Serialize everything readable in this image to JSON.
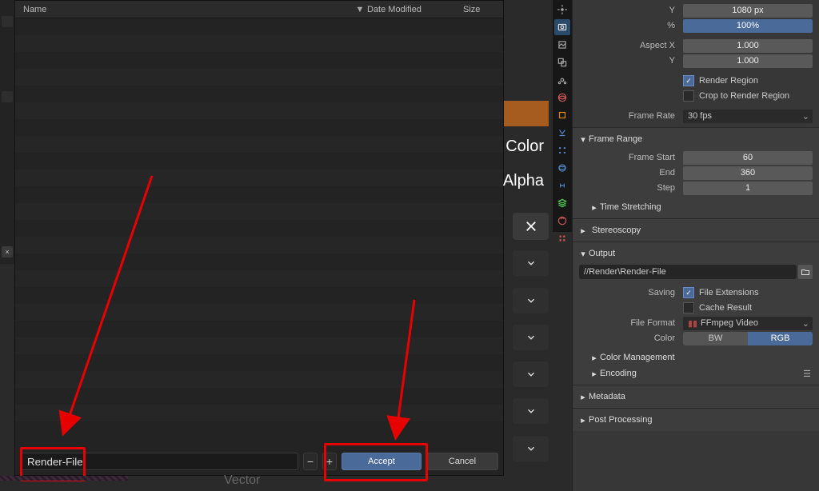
{
  "file_browser": {
    "cols": {
      "name": "Name",
      "date": "Date Modified",
      "size": "Size"
    },
    "sort_indicator": "▼",
    "filename": "Render-File",
    "minus": "−",
    "plus": "+",
    "accept": "Accept",
    "cancel": "Cancel",
    "rail_x": "×"
  },
  "mid": {
    "color": "Color",
    "alpha": "Alpha",
    "close": "×",
    "below_text": "Vector"
  },
  "props": {
    "res_y_label": "Y",
    "res_y": "1080 px",
    "pct_label": "%",
    "pct": "100%",
    "aspect_x_label": "Aspect X",
    "aspect_x": "1.000",
    "aspect_y_label": "Y",
    "aspect_y": "1.000",
    "render_region": "Render Region",
    "crop_region": "Crop to Render Region",
    "frame_rate_label": "Frame Rate",
    "frame_rate": "30 fps",
    "sections": {
      "frame_range": "Frame Range",
      "time_stretching": "Time Stretching",
      "stereoscopy": "Stereoscopy",
      "output": "Output",
      "color_mgmt": "Color Management",
      "encoding": "Encoding",
      "metadata": "Metadata",
      "post_processing": "Post Processing"
    },
    "frame_start_label": "Frame Start",
    "frame_start": "60",
    "frame_end_label": "End",
    "frame_end": "360",
    "frame_step_label": "Step",
    "frame_step": "1",
    "output_path": "//Render\\Render-File",
    "saving_label": "Saving",
    "file_ext": "File Extensions",
    "cache_result": "Cache Result",
    "file_format_label": "File Format",
    "file_format": "FFmpeg Video",
    "color_label": "Color",
    "bw": "BW",
    "rgb": "RGB"
  }
}
